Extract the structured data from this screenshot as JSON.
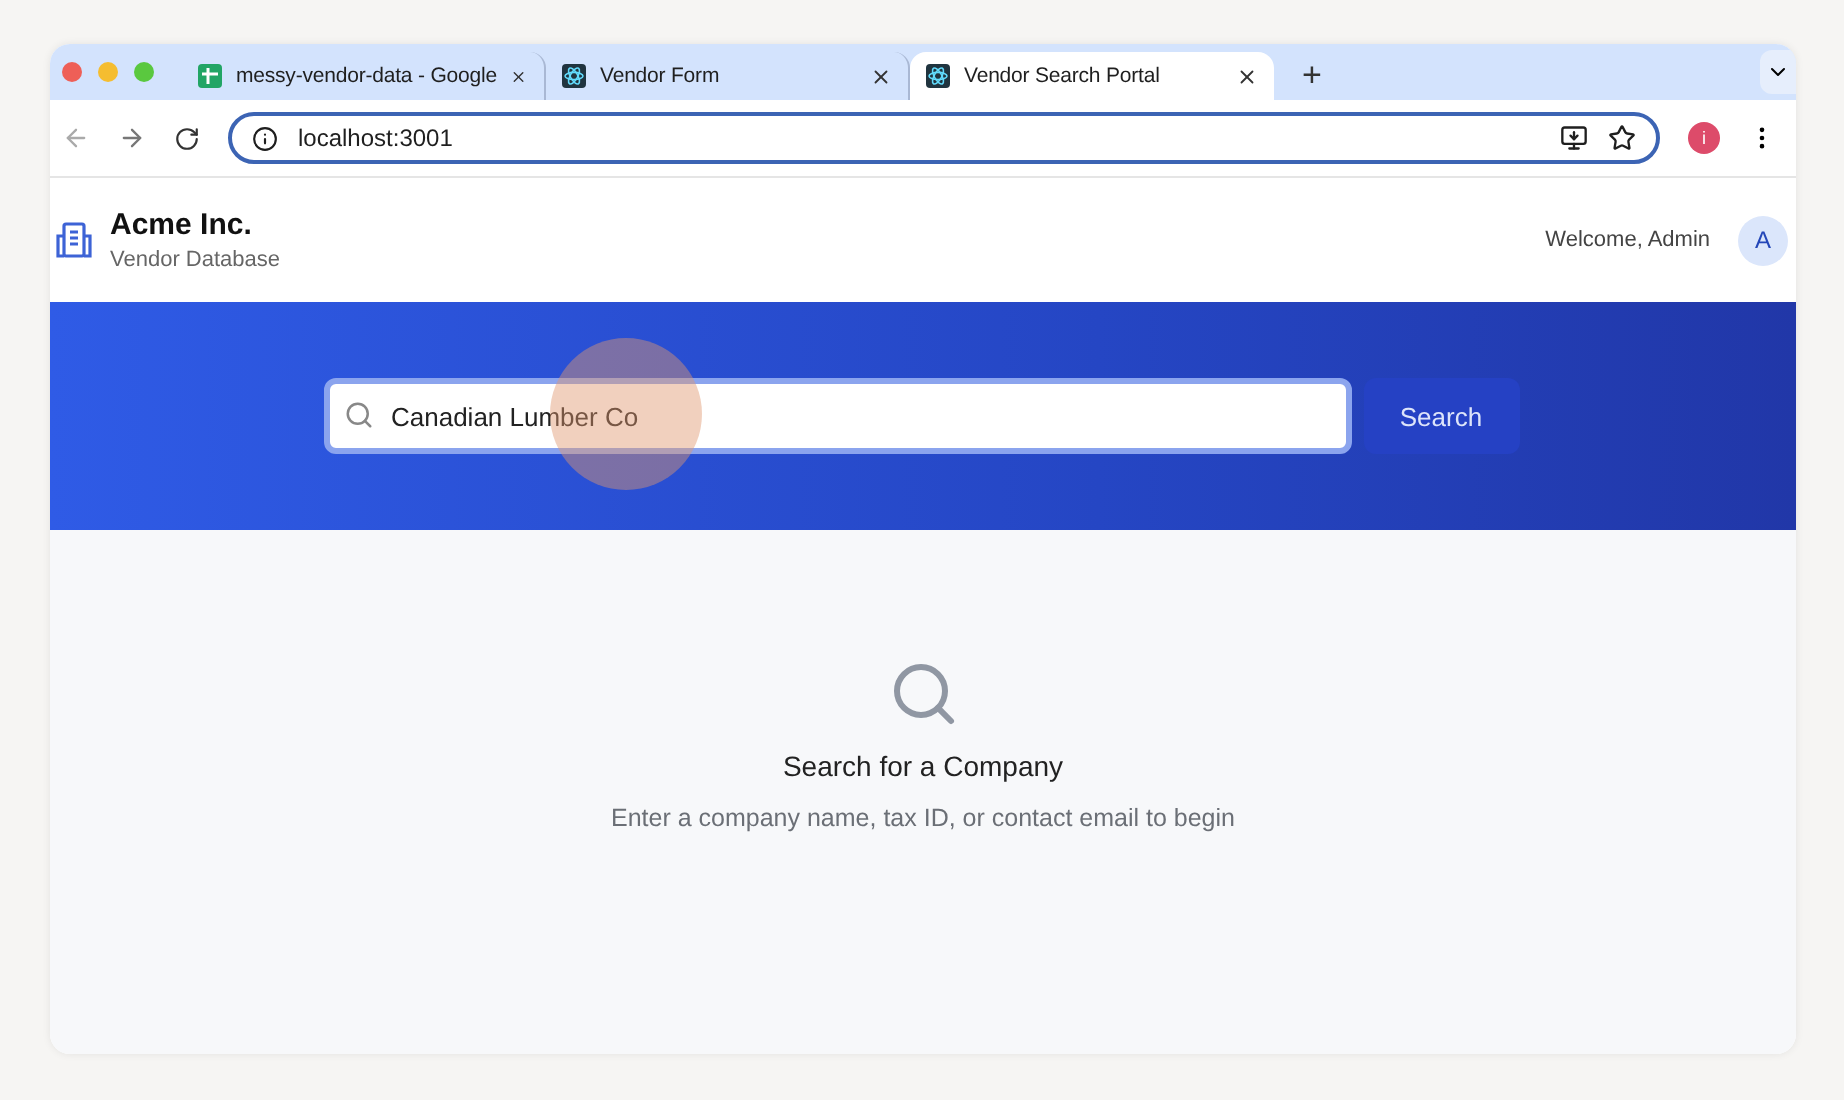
{
  "browser": {
    "tabs": [
      {
        "title": "messy-vendor-data - Google",
        "kind": "sheets",
        "selected": false
      },
      {
        "title": "Vendor Form",
        "kind": "react",
        "selected": false
      },
      {
        "title": "Vendor Search Portal",
        "kind": "react",
        "selected": true
      }
    ],
    "new_tab": "+",
    "address": "localhost:3001",
    "profile_initial": "i"
  },
  "header": {
    "company": "Acme Inc.",
    "subtitle": "Vendor Database",
    "welcome": "Welcome, Admin",
    "avatar": "A"
  },
  "search": {
    "value": "Canadian Lumber Co",
    "button": "Search"
  },
  "empty_state": {
    "title": "Search for a Company",
    "message": "Enter a company name, tax ID, or contact email to begin"
  }
}
